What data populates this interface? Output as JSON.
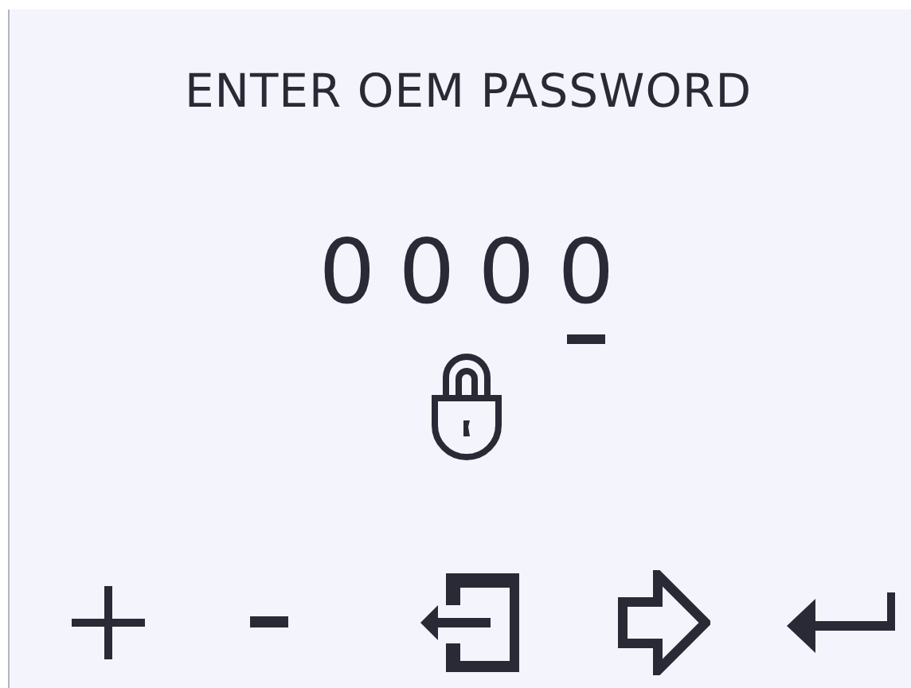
{
  "title": "ENTER OEM PASSWORD",
  "digits": [
    {
      "value": "0",
      "selected": false
    },
    {
      "value": "0",
      "selected": false
    },
    {
      "value": "0",
      "selected": false
    },
    {
      "value": "0",
      "selected": true
    }
  ],
  "locked": true,
  "buttons": [
    {
      "kind": "plus"
    },
    {
      "kind": "minus"
    },
    {
      "kind": "exit"
    },
    {
      "kind": "next"
    },
    {
      "kind": "enter"
    }
  ]
}
